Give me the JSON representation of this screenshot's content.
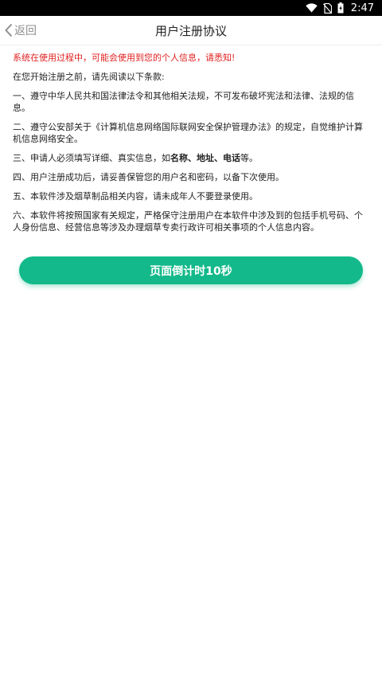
{
  "status_bar": {
    "time": "2:47"
  },
  "nav": {
    "back_label": "返回",
    "title": "用户注册协议"
  },
  "agreement": {
    "notice": "系统在使用过程中，可能会使用到您的个人信息，请悉知!",
    "intro": "在您开始注册之前，请先阅读以下条款:",
    "item1": "一、遵守中华人民共和国法律法令和其他相关法规，不可发布破坏宪法和法律、法规的信息。",
    "item2": "二、遵守公安部关于《计算机信息网络国际联网安全保护管理办法》的规定，自觉维护计算机信息网络安全。",
    "item3_prefix": "三、申请人必须填写详细、真实信息，如",
    "item3_bold1": "名称",
    "item3_sep1": "、",
    "item3_bold2": "地址",
    "item3_sep2": "、",
    "item3_bold3": "电话",
    "item3_suffix": "等。",
    "item4": "四、用户注册成功后，请妥善保管您的用户名和密码，以备下次使用。",
    "item5": "五、本软件涉及烟草制品相关内容，请未成年人不要登录使用。",
    "item6": "六、本软件将按照国家有关规定，严格保守注册用户在本软件中涉及到的包括手机号码、个人身份信息、经营信息等涉及办理烟草专卖行政许可相关事项的个人信息内容。"
  },
  "countdown_button": {
    "label": "页面倒计时10秒"
  },
  "colors": {
    "accent": "#13b98a",
    "notice": "#e02020"
  }
}
